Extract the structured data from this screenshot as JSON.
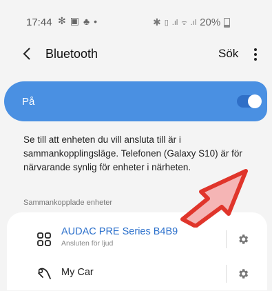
{
  "status_bar": {
    "time": "17:44",
    "left_icons": [
      "fan-icon",
      "gallery-icon",
      "person-icon",
      "dot"
    ],
    "right_icons": [
      "bluetooth-icon",
      "vibrate-icon",
      "signal-icon",
      "wifi-icon",
      "signal-icon"
    ],
    "battery": "20%"
  },
  "app_bar": {
    "title": "Bluetooth",
    "search_label": "Sök"
  },
  "toggle": {
    "label": "På",
    "state": "on",
    "accent": "#4a90e2"
  },
  "description": "Se till att enheten du vill ansluta till är i sammankopplingsläge. Telefonen (Galaxy S10) är för närvarande synlig för enheter i närheten.",
  "paired": {
    "header": "Sammankopplade enheter",
    "devices": [
      {
        "name": "AUDAC PRE Series B4B9",
        "subtitle": "Ansluten för ljud",
        "icon": "grid-device-icon",
        "name_color": "#2a6fcb"
      },
      {
        "name": "My Car",
        "subtitle": "",
        "icon": "car-key-icon",
        "name_color": "#222222"
      }
    ]
  },
  "annotation": {
    "icon": "red-arrow-icon",
    "color": "#e0352b"
  }
}
